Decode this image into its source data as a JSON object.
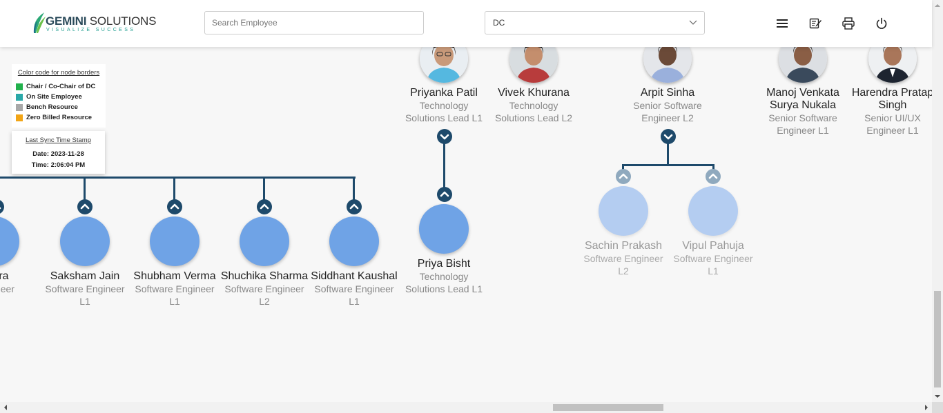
{
  "app": {
    "brand": "GEMINI",
    "brand_rest": " SOLUTIONS",
    "tagline": "VISUALIZE SUCCESS"
  },
  "header": {
    "search_placeholder": "Search Employee",
    "search_value": "",
    "dc_select_value": "DC",
    "icons": [
      "menu-icon",
      "notes-icon",
      "print-icon",
      "power-icon"
    ]
  },
  "legend": {
    "title": "Color code for node borders",
    "items": [
      {
        "label": "Chair / Co-Chair of DC",
        "color": "#22b14c"
      },
      {
        "label": "On Site Employee",
        "color": "#2aa8a8"
      },
      {
        "label": "Bench Resource",
        "color": "#a8a8a8"
      },
      {
        "label": "Zero Billed Resource",
        "color": "#f2a516"
      }
    ]
  },
  "sync": {
    "title": "Last Sync Time Stamp",
    "date": "Date: 2023-11-28",
    "time": "Time: 2:06:04 PM"
  },
  "top_nodes": [
    {
      "name": "Priyanka Patil",
      "desg": "Technology Solutions Lead L1"
    },
    {
      "name": "Vivek Khurana",
      "desg": "Technology Solutions Lead L2"
    },
    {
      "name": "Arpit Sinha",
      "desg": "Senior Software Engineer L2"
    },
    {
      "name": "Manoj Venkata Surya Nukala",
      "desg": "Senior Software Engineer L1"
    },
    {
      "name": "Harendra Pratap Singh",
      "desg": "Senior UI/UX Engineer L1"
    }
  ],
  "left_children": [
    {
      "name": "Arora",
      "desg": "Engineer"
    },
    {
      "name": "Saksham Jain",
      "desg": "Software Engineer L1"
    },
    {
      "name": "Shubham Verma",
      "desg": "Software Engineer L1"
    },
    {
      "name": "Shuchika Sharma",
      "desg": "Software Engineer L2"
    },
    {
      "name": "Siddhant Kaushal",
      "desg": "Software Engineer L1"
    }
  ],
  "priyanka_child": {
    "name": "Priya Bisht",
    "desg": "Technology Solutions Lead L1"
  },
  "arpit_children": [
    {
      "name": "Sachin Prakash",
      "desg": "Software Engineer L2"
    },
    {
      "name": "Vipul Pahuja",
      "desg": "Software Engineer L1"
    }
  ],
  "colors": {
    "line": "#1e4a6b",
    "node_fill": "#6fa3e6",
    "node_fill_faded": "#b4cdf1"
  }
}
